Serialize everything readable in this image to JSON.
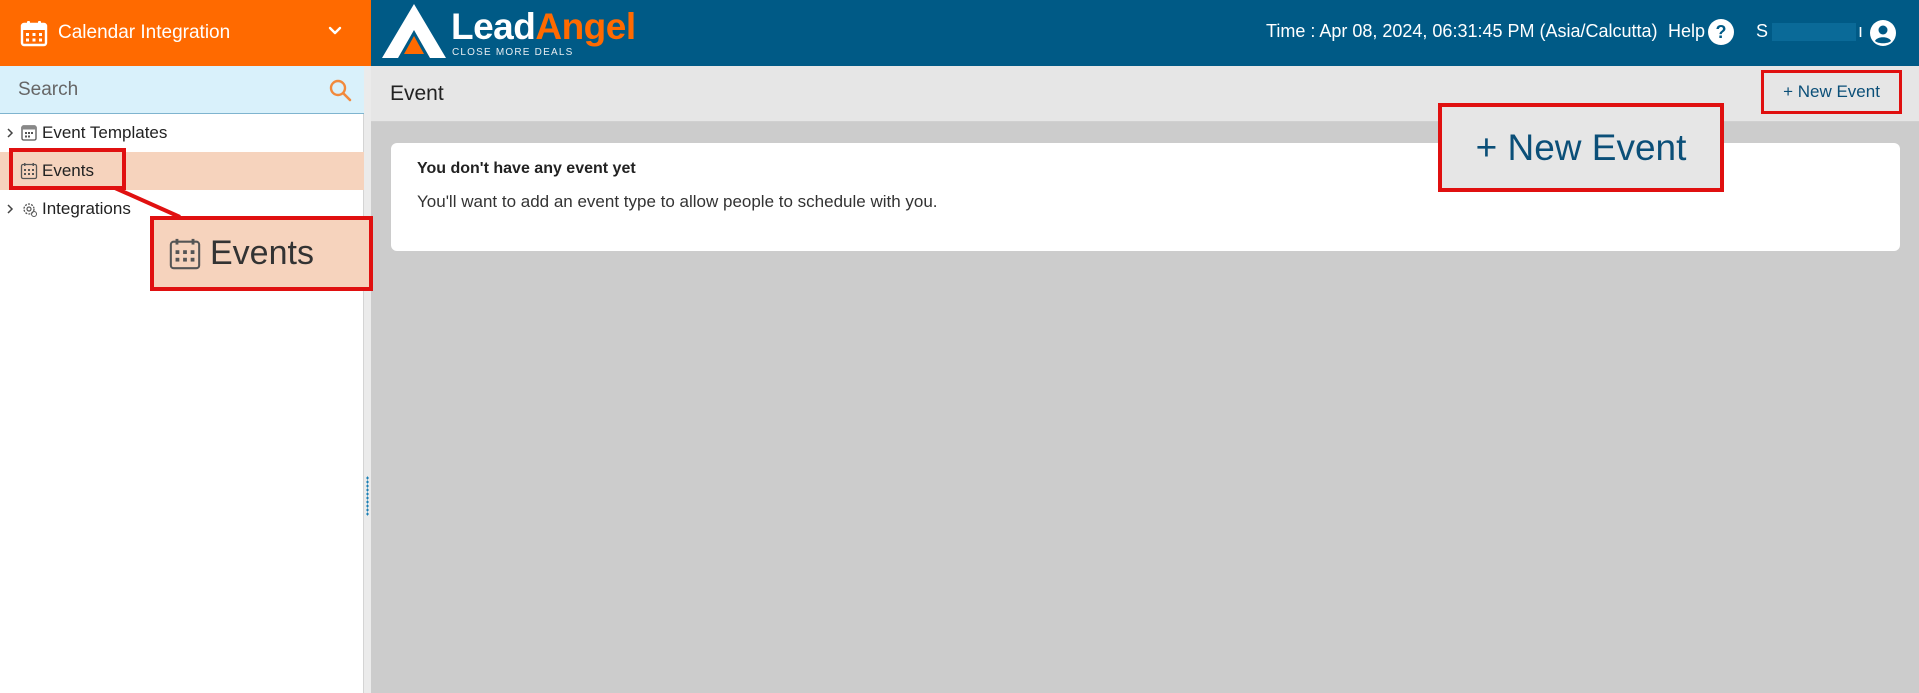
{
  "module": {
    "label": "Calendar Integration"
  },
  "brand": {
    "lead": "Lead",
    "angel": "Angel",
    "tagline": "CLOSE MORE DEALS"
  },
  "header": {
    "time": "Time : Apr 08, 2024, 06:31:45 PM (Asia/Calcutta)",
    "help": "Help",
    "help_icon": "?",
    "user_initial": "S",
    "user_suffix": "ı"
  },
  "sidebar": {
    "search_placeholder": "Search",
    "items": [
      {
        "label": "Event Templates",
        "icon": "template-icon",
        "selected": false
      },
      {
        "label": "Events",
        "icon": "calendar-grid-icon",
        "selected": true
      },
      {
        "label": "Integrations",
        "icon": "gear-icon",
        "selected": false
      }
    ]
  },
  "main": {
    "title": "Event",
    "new_event_label": "+ New Event",
    "empty_heading": "You don't have any event yet",
    "empty_description": "You'll want to add an event type to allow people to schedule with you."
  },
  "callouts": {
    "new_event_label": "+ New Event",
    "events_label": "Events"
  },
  "colors": {
    "header_bg": "#005a86",
    "module_bg": "#ff6a00",
    "selected_bg": "#f6d3bd",
    "highlight_red": "#e01010",
    "button_text": "#0b4f78"
  }
}
